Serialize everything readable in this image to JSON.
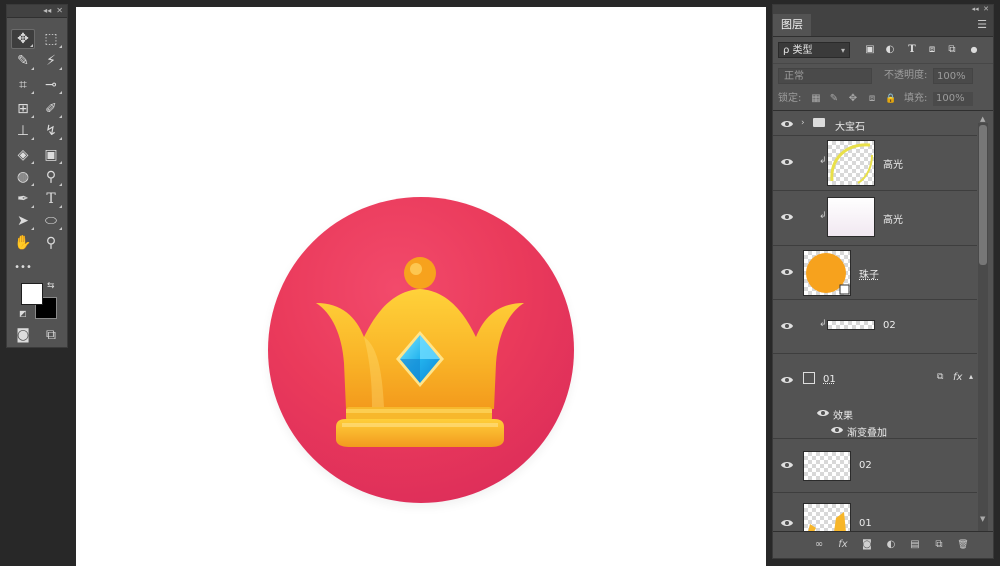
{
  "toolbar": {
    "collapse": "◂◂",
    "close": "✕",
    "tools": [
      {
        "name": "move-tool",
        "glyph": "✥"
      },
      {
        "name": "marquee-tool",
        "glyph": "⬚"
      },
      {
        "name": "lasso-tool",
        "glyph": "✎"
      },
      {
        "name": "magic-wand-tool",
        "glyph": "⚡"
      },
      {
        "name": "crop-tool",
        "glyph": "⌗"
      },
      {
        "name": "eyedropper-tool",
        "glyph": "⊸"
      },
      {
        "name": "healing-brush-tool",
        "glyph": "⊞"
      },
      {
        "name": "brush-tool",
        "glyph": "✐"
      },
      {
        "name": "clone-stamp-tool",
        "glyph": "⊥"
      },
      {
        "name": "history-brush-tool",
        "glyph": "↯"
      },
      {
        "name": "eraser-tool",
        "glyph": "◈"
      },
      {
        "name": "gradient-tool",
        "glyph": "▣"
      },
      {
        "name": "blur-tool",
        "glyph": "◍"
      },
      {
        "name": "dodge-tool",
        "glyph": "⚲"
      },
      {
        "name": "pen-tool",
        "glyph": "✒"
      },
      {
        "name": "type-tool",
        "glyph": "T"
      },
      {
        "name": "path-selection-tool",
        "glyph": "➤"
      },
      {
        "name": "ellipse-tool",
        "glyph": "⬭"
      },
      {
        "name": "hand-tool",
        "glyph": "✋"
      },
      {
        "name": "zoom-tool",
        "glyph": "⚲"
      },
      {
        "name": "more-tools",
        "glyph": "•••"
      }
    ],
    "bottom_left": "◙",
    "bottom_right": "⧉"
  },
  "layers_panel": {
    "collapse": "◂◂",
    "close": "✕",
    "tab": "图层",
    "menu": "☰",
    "filter": {
      "kind_label": "ρ 类型",
      "arrow": "▾"
    },
    "filter_icons": [
      "▣",
      "◐",
      "T",
      "⧈",
      "⧉",
      "●"
    ],
    "blend_mode": "正常",
    "opacity_label": "不透明度:",
    "opacity_value": "100%",
    "lock_label": "锁定:",
    "lock_icons": [
      "▦",
      "✎",
      "✥",
      "⧈",
      "🔒"
    ],
    "fill_label": "填充:",
    "fill_value": "100%",
    "layers": [
      {
        "type": "group",
        "name": "大宝石"
      },
      {
        "type": "layer",
        "name": "高光",
        "clipped": true,
        "thumb": "ring"
      },
      {
        "type": "layer",
        "name": "高光",
        "clipped": true,
        "thumb": "white"
      },
      {
        "type": "layer",
        "name": "珠子",
        "clipped": false,
        "thumb": "orange"
      },
      {
        "type": "layer",
        "name": "02",
        "clipped": true,
        "thumb": "strip"
      },
      {
        "type": "shape",
        "name": "01",
        "fx": "fx"
      },
      {
        "type": "effects",
        "label": "效果"
      },
      {
        "type": "effect",
        "label": "渐变叠加"
      },
      {
        "type": "layer",
        "name": "02",
        "clipped": false,
        "thumb": "transparent"
      },
      {
        "type": "layer",
        "name": "01",
        "clipped": false,
        "thumb": "partial"
      }
    ],
    "footer_icons": [
      "∞",
      "fx",
      "◙",
      "◐",
      "▤",
      "⧉",
      "🗑"
    ]
  },
  "colors": {
    "badge": "#e8385b",
    "crown": "#f7b62a",
    "gem": "#2ec0f0",
    "panel_bg": "#535353",
    "app_bg": "#282828"
  }
}
